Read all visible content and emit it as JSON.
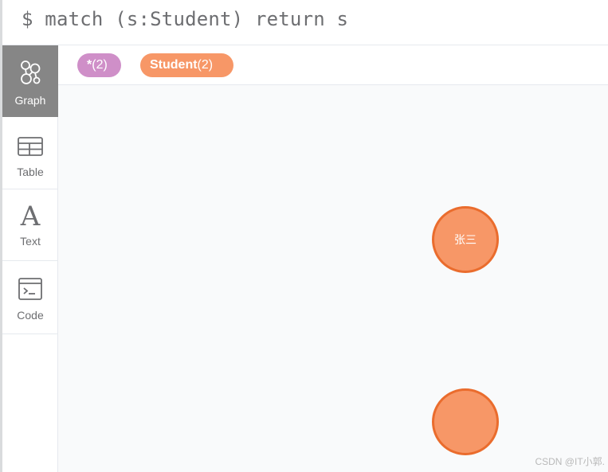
{
  "query": {
    "text": "$ match (s:Student) return s"
  },
  "sidebar": {
    "items": [
      {
        "label": "Graph",
        "icon": "graph-icon",
        "active": true
      },
      {
        "label": "Table",
        "icon": "table-icon",
        "active": false
      },
      {
        "label": "Text",
        "icon": "text-icon",
        "active": false
      },
      {
        "label": "Code",
        "icon": "code-icon",
        "active": false
      }
    ]
  },
  "legend": {
    "all": {
      "label": "*",
      "count": "(2)",
      "color": "#cf8fc8"
    },
    "student": {
      "label": "Student",
      "count": "(2)",
      "color": "#f79767"
    }
  },
  "graph": {
    "node_color": "#f79767",
    "node_border": "#ea6c2d",
    "nodes": [
      {
        "caption": "张三"
      },
      {
        "caption": ""
      }
    ]
  },
  "watermark": "CSDN @IT小郭."
}
